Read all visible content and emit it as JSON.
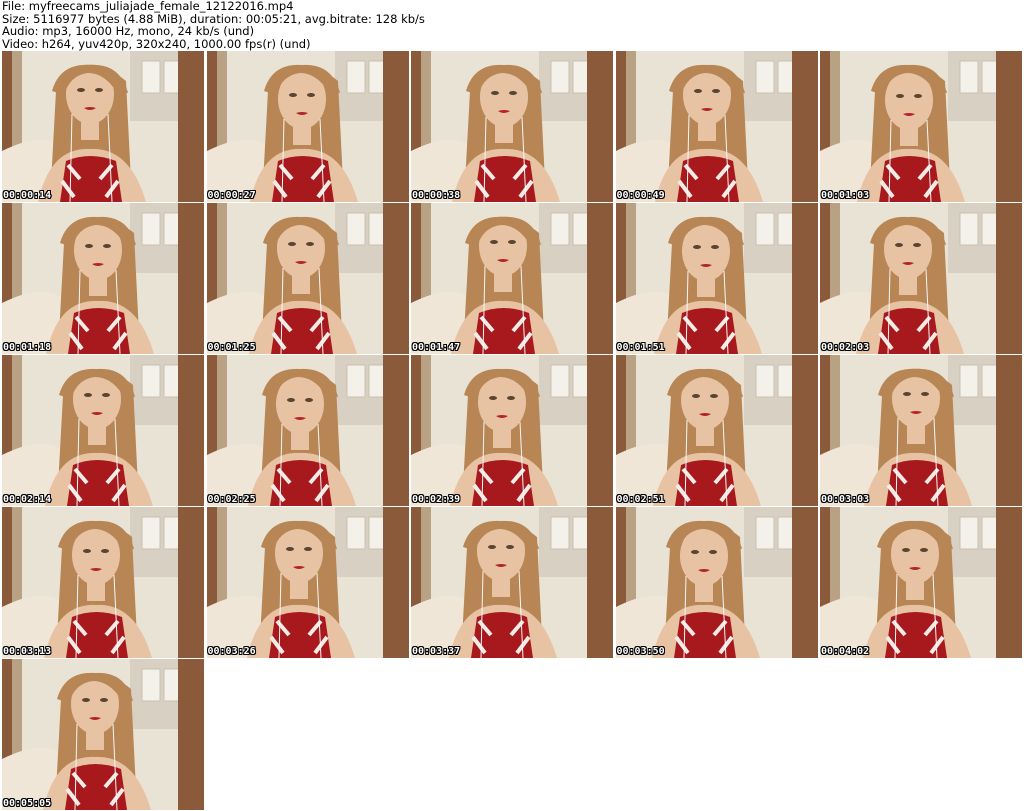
{
  "header": {
    "file": "File: myfreecams_juliajade_female_12122016.mp4",
    "size": "Size: 5116977 bytes (4.88 MiB), duration: 00:05:21, avg.bitrate: 128 kb/s",
    "audio": "Audio: mp3, 16000 Hz, mono, 24 kb/s (und)",
    "video": "Video: h264, yuv420p, 320x240, 1000.00 fps(r) (und)"
  },
  "thumbnails": [
    {
      "timestamp": "00:00:14"
    },
    {
      "timestamp": "00:00:27"
    },
    {
      "timestamp": "00:00:38"
    },
    {
      "timestamp": "00:00:49"
    },
    {
      "timestamp": "00:01:03"
    },
    {
      "timestamp": "00:01:18"
    },
    {
      "timestamp": "00:01:25"
    },
    {
      "timestamp": "00:01:47"
    },
    {
      "timestamp": "00:01:51"
    },
    {
      "timestamp": "00:02:03"
    },
    {
      "timestamp": "00:02:14"
    },
    {
      "timestamp": "00:02:25"
    },
    {
      "timestamp": "00:02:39"
    },
    {
      "timestamp": "00:02:51"
    },
    {
      "timestamp": "00:03:03"
    },
    {
      "timestamp": "00:03:13"
    },
    {
      "timestamp": "00:03:26"
    },
    {
      "timestamp": "00:03:37"
    },
    {
      "timestamp": "00:03:50"
    },
    {
      "timestamp": "00:04:02"
    },
    {
      "timestamp": "00:05:05"
    }
  ],
  "colors": {
    "background": "#ffffff",
    "wall": "#e9e3d6",
    "wood": "#8a5a3a",
    "hair": "#b78654",
    "skin": "#e8c3a3",
    "top_red": "#a8191e",
    "top_stripe": "#f3ece6",
    "lips": "#b2242c"
  }
}
